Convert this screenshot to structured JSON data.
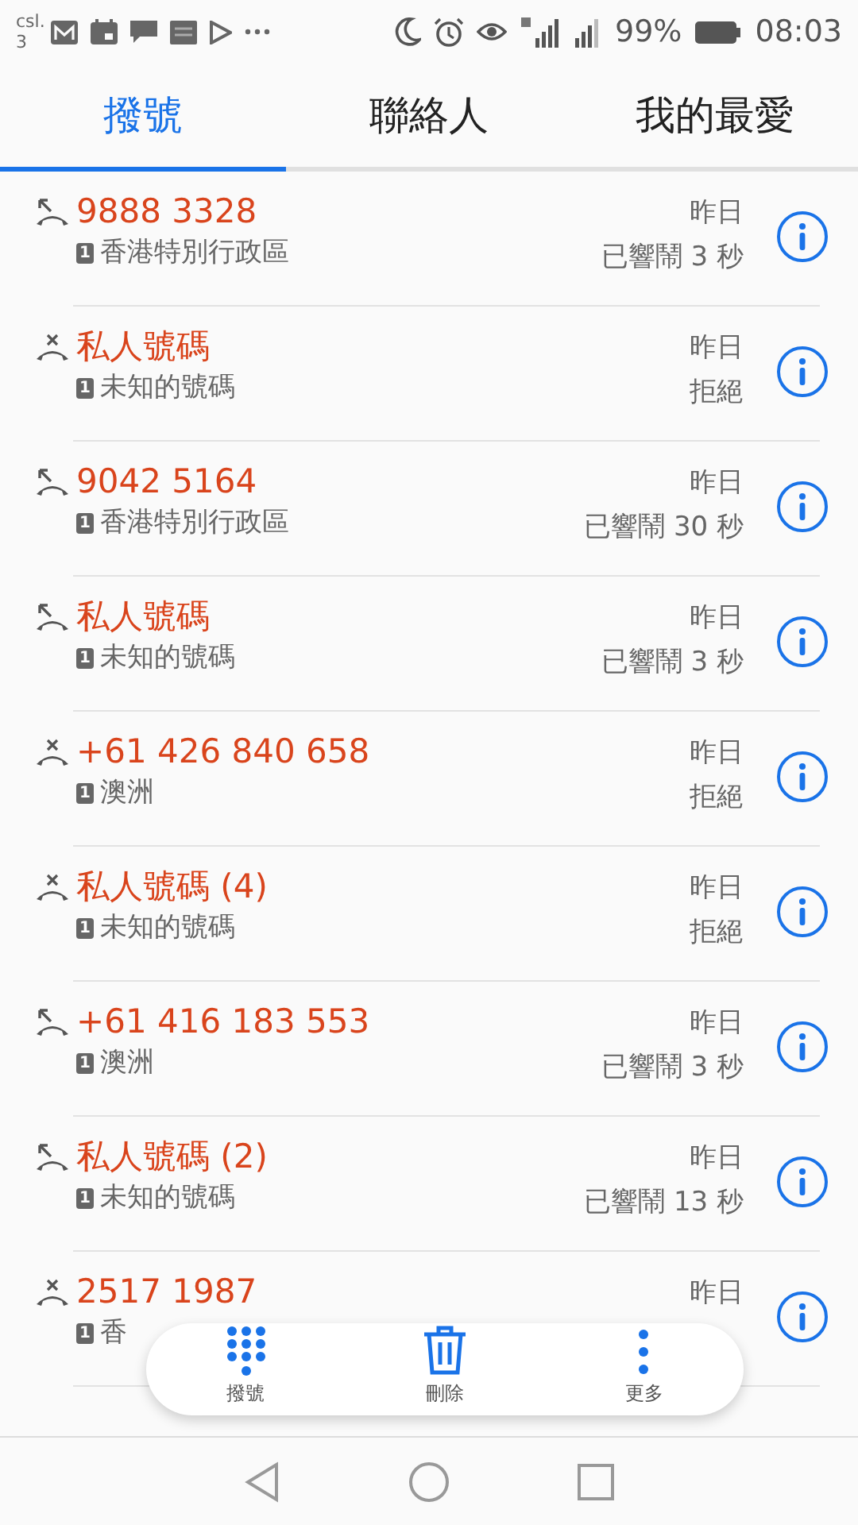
{
  "status_bar": {
    "carrier": "csl.",
    "carrier_line2": "3",
    "battery_text": "99%",
    "time": "08:03"
  },
  "tabs": [
    {
      "label": "撥號",
      "selected": true
    },
    {
      "label": "聯絡人",
      "selected": false
    },
    {
      "label": "我的最愛",
      "selected": false
    }
  ],
  "calls": [
    {
      "name": "9888 3328",
      "kind": "missed",
      "sim": "1",
      "location": "香港特別行政區",
      "time": "昨日",
      "detail": "已響鬧 3 秒"
    },
    {
      "name": "私人號碼",
      "kind": "rejected",
      "sim": "1",
      "location": "未知的號碼",
      "time": "昨日",
      "detail": "拒絕"
    },
    {
      "name": "9042 5164",
      "kind": "missed",
      "sim": "1",
      "location": "香港特別行政區",
      "time": "昨日",
      "detail": "已響鬧 30 秒"
    },
    {
      "name": "私人號碼",
      "kind": "missed",
      "sim": "1",
      "location": "未知的號碼",
      "time": "昨日",
      "detail": "已響鬧 3 秒"
    },
    {
      "name": "+61 426 840 658",
      "kind": "rejected",
      "sim": "1",
      "location": "澳洲",
      "time": "昨日",
      "detail": "拒絕"
    },
    {
      "name": "私人號碼 (4)",
      "kind": "rejected",
      "sim": "1",
      "location": "未知的號碼",
      "time": "昨日",
      "detail": "拒絕"
    },
    {
      "name": "+61 416 183 553",
      "kind": "missed",
      "sim": "1",
      "location": "澳洲",
      "time": "昨日",
      "detail": "已響鬧 3 秒"
    },
    {
      "name": "私人號碼 (2)",
      "kind": "missed",
      "sim": "1",
      "location": "未知的號碼",
      "time": "昨日",
      "detail": "已響鬧 13 秒"
    },
    {
      "name": "2517 1987",
      "kind": "rejected",
      "sim": "1",
      "location": "香",
      "time": "昨日"
    }
  ],
  "action_bar": [
    {
      "kind": "dialpad",
      "label": "撥號"
    },
    {
      "kind": "delete",
      "label": "刪除"
    },
    {
      "kind": "more",
      "label": "更多"
    }
  ]
}
